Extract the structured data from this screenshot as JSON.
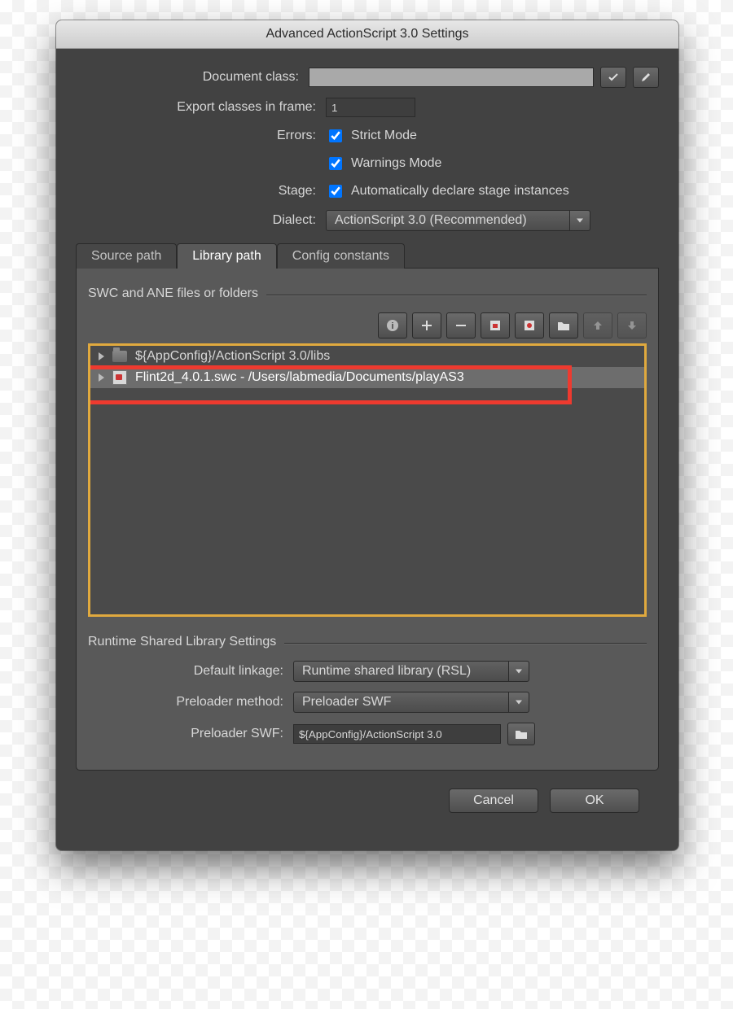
{
  "title": "Advanced ActionScript 3.0 Settings",
  "labels": {
    "document_class": "Document class:",
    "export_frame": "Export classes in frame:",
    "errors": "Errors:",
    "stage": "Stage:",
    "dialect": "Dialect:"
  },
  "fields": {
    "document_class": "",
    "export_frame": "1"
  },
  "checkboxes": {
    "strict_mode": "Strict Mode",
    "warnings_mode": "Warnings Mode",
    "declare_stage": "Automatically declare stage instances"
  },
  "dialect_value": "ActionScript 3.0 (Recommended)",
  "tabs": {
    "source_path": "Source path",
    "library_path": "Library path",
    "config_constants": "Config constants"
  },
  "library": {
    "group_title": "SWC and ANE files or folders",
    "rows": [
      "${AppConfig}/ActionScript 3.0/libs",
      "Flint2d_4.0.1.swc - /Users/labmedia/Documents/playAS3"
    ]
  },
  "rsl": {
    "section_title": "Runtime Shared Library Settings",
    "default_linkage_label": "Default linkage:",
    "default_linkage_value": "Runtime shared library (RSL)",
    "preloader_method_label": "Preloader method:",
    "preloader_method_value": "Preloader SWF",
    "preloader_swf_label": "Preloader SWF:",
    "preloader_swf_value": "${AppConfig}/ActionScript 3.0"
  },
  "buttons": {
    "cancel": "Cancel",
    "ok": "OK"
  }
}
